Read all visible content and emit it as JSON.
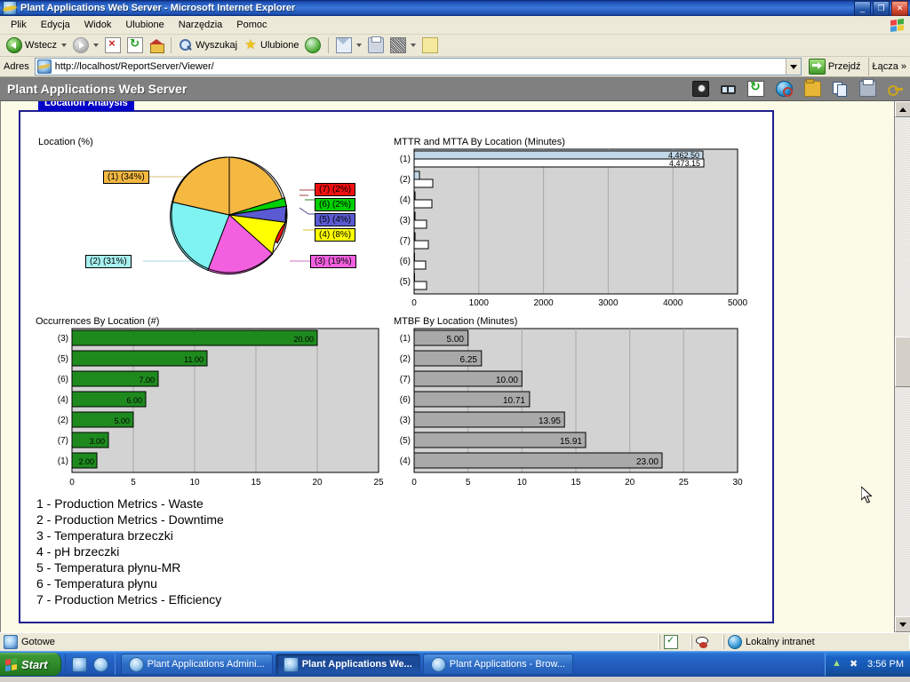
{
  "window": {
    "title": "Plant Applications Web Server - Microsoft Internet Explorer",
    "minimize": "_",
    "maximize": "❐",
    "close": "✕"
  },
  "menu": {
    "items": [
      {
        "label": "Plik"
      },
      {
        "label": "Edycja"
      },
      {
        "label": "Widok"
      },
      {
        "label": "Ulubione"
      },
      {
        "label": "Narzędzia"
      },
      {
        "label": "Pomoc"
      }
    ]
  },
  "toolbar": {
    "back_label": "Wstecz",
    "search_label": "Wyszukaj",
    "favorites_label": "Ulubione",
    "icons": [
      "back-icon",
      "forward-icon",
      "stop-icon",
      "refresh-icon",
      "home-icon",
      "search-icon",
      "favorites-star-icon",
      "history-icon",
      "mail-icon",
      "print-icon",
      "edit-icon",
      "notes-icon"
    ]
  },
  "address": {
    "label": "Adres",
    "url": "http://localhost/ReportServer/Viewer/",
    "go_label": "Przejdź",
    "links_label": "Łącza",
    "links_chevron": "»"
  },
  "app_header": {
    "title": "Plant Applications Web Server",
    "icons": [
      "camera-icon",
      "glasses-icon",
      "refresh-icon",
      "globe-search-icon",
      "folder-icon",
      "copy-icon",
      "print-icon",
      "key-icon"
    ]
  },
  "report": {
    "tab_label": "Location Analysis",
    "legend": [
      "1 - Production Metrics - Waste",
      "2 - Production Metrics - Downtime",
      "3 - Temperatura brzeczki",
      "4 - pH brzeczki",
      "5 - Temperatura płynu-MR",
      "6 - Temperatura płynu",
      "7 - Production Metrics - Efficiency"
    ]
  },
  "chart_data": [
    {
      "id": "location-pie",
      "type": "pie",
      "title": "Location (%)",
      "categories": [
        "(1)",
        "(2)",
        "(3)",
        "(4)",
        "(5)",
        "(6)",
        "(7)"
      ],
      "values": [
        34,
        31,
        19,
        8,
        4,
        2,
        2
      ],
      "labels": [
        "(1) (34%)",
        "(2) (31%)",
        "(3) (19%)",
        "(4) (8%)",
        "(5) (4%)",
        "(6) (2%)",
        "(7) (2%)"
      ],
      "colors": [
        "#F5B942",
        "#7FF2F2",
        "#F260E0",
        "#FFFF00",
        "#5A5AD2",
        "#00D000",
        "#F01010"
      ],
      "unit": "%",
      "legend_position": "callout-labels"
    },
    {
      "id": "mttr-mtta-by-location",
      "type": "bar",
      "orientation": "horizontal",
      "title": "MTTR and MTTA By Location (Minutes)",
      "categories": [
        "(1)",
        "(2)",
        "(4)",
        "(3)",
        "(7)",
        "(6)",
        "(5)"
      ],
      "series": [
        {
          "name": "MTTA",
          "color": "#C3D8E8",
          "values": [
            4462.5,
            75,
            11,
            10,
            9,
            3,
            2
          ]
        },
        {
          "name": "MTTR",
          "color": "#FFFFFF",
          "values": [
            4473.15,
            285,
            270,
            197,
            215,
            182,
            197
          ]
        }
      ],
      "data_labels": [
        "4,462.50",
        "4,473.15"
      ],
      "xlabel": "",
      "ylabel": "",
      "xlim": [
        0,
        5000
      ],
      "xticks": [
        0,
        1000,
        2000,
        3000,
        4000,
        5000
      ],
      "grid": true,
      "plot_bg": "#D3D3D3"
    },
    {
      "id": "occurrences-by-location",
      "type": "bar",
      "orientation": "horizontal",
      "title": "Occurrences By Location (#)",
      "categories": [
        "(3)",
        "(5)",
        "(6)",
        "(4)",
        "(2)",
        "(7)",
        "(1)"
      ],
      "values": [
        20.0,
        11.0,
        7.0,
        6.0,
        5.0,
        3.0,
        2.0
      ],
      "value_labels": [
        "20.00",
        "11.00",
        "7.00",
        "6.00",
        "5.00",
        "3.00",
        "2.00"
      ],
      "bar_color": "#1E8A1E",
      "xlim": [
        0,
        25
      ],
      "xticks": [
        0,
        5,
        10,
        15,
        20,
        25
      ],
      "grid": true,
      "plot_bg": "#D3D3D3"
    },
    {
      "id": "mtbf-by-location",
      "type": "bar",
      "orientation": "horizontal",
      "title": "MTBF By Location (Minutes)",
      "categories": [
        "(1)",
        "(2)",
        "(7)",
        "(6)",
        "(3)",
        "(5)",
        "(4)"
      ],
      "values": [
        5.0,
        6.25,
        10.0,
        10.71,
        13.95,
        15.91,
        23.0
      ],
      "value_labels": [
        "5.00",
        "6.25",
        "10.00",
        "10.71",
        "13.95",
        "15.91",
        "23.00"
      ],
      "bar_color": "#A9A9A9",
      "xlim": [
        0,
        30
      ],
      "xticks": [
        0,
        5,
        10,
        15,
        20,
        25,
        30
      ],
      "grid": true,
      "plot_bg": "#D3D3D3"
    }
  ],
  "statusbar": {
    "message": "Gotowe",
    "zone": "Lokalny intranet"
  },
  "taskbar": {
    "start_label": "Start",
    "buttons": [
      {
        "label": "Plant Applications Admini...",
        "active": false
      },
      {
        "label": "Plant Applications We...",
        "active": true
      },
      {
        "label": "Plant Applications - Brow...",
        "active": false
      }
    ],
    "clock": "3:56 PM",
    "tray_icons": [
      "language-indicator",
      "antivirus-icon"
    ]
  }
}
